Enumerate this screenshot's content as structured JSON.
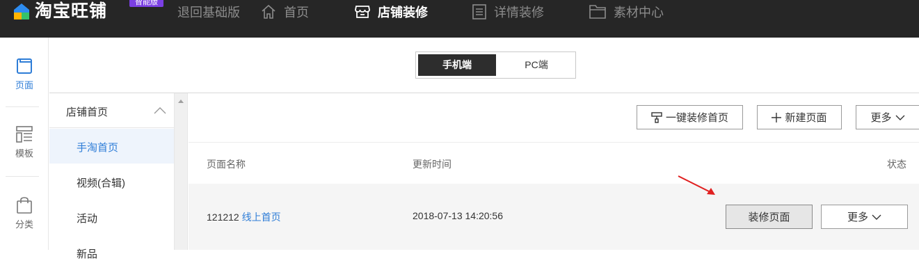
{
  "topbar": {
    "logo_text": "淘宝旺铺",
    "badge": "智能版",
    "nav": [
      {
        "label": "退回基础版",
        "icon": "none"
      },
      {
        "label": "首页",
        "icon": "home-icon"
      },
      {
        "label": "店铺装修",
        "icon": "shop-icon",
        "active": true
      },
      {
        "label": "详情装修",
        "icon": "document-icon"
      },
      {
        "label": "素材中心",
        "icon": "folder-icon"
      }
    ]
  },
  "rail": {
    "items": [
      {
        "label": "页面",
        "icon": "page-icon",
        "active": true
      },
      {
        "label": "模板",
        "icon": "template-icon"
      },
      {
        "label": "分类",
        "icon": "bag-icon"
      }
    ]
  },
  "device_switch": {
    "mobile": "手机端",
    "pc": "PC端",
    "selected": "手机端"
  },
  "pagelist": {
    "header": "店铺首页",
    "items": [
      "手淘首页",
      "视频(合辑)",
      "活动",
      "新品"
    ],
    "active": "手淘首页"
  },
  "toolbar": {
    "one_click": "一键装修首页",
    "new_page": "新建页面",
    "more": "更多"
  },
  "table": {
    "headers": {
      "name": "页面名称",
      "updated": "更新时间",
      "status": "状态"
    },
    "rows": [
      {
        "id": "121212",
        "name": "线上首页",
        "updated": "2018-07-13 14:20:56",
        "decorate": "装修页面",
        "more": "更多"
      }
    ]
  },
  "colors": {
    "topbar_bg": "#262626",
    "accent_blue": "#2e7dd7",
    "badge_purple": "#7b3fe4",
    "annotation_arrow": "#e02020"
  }
}
